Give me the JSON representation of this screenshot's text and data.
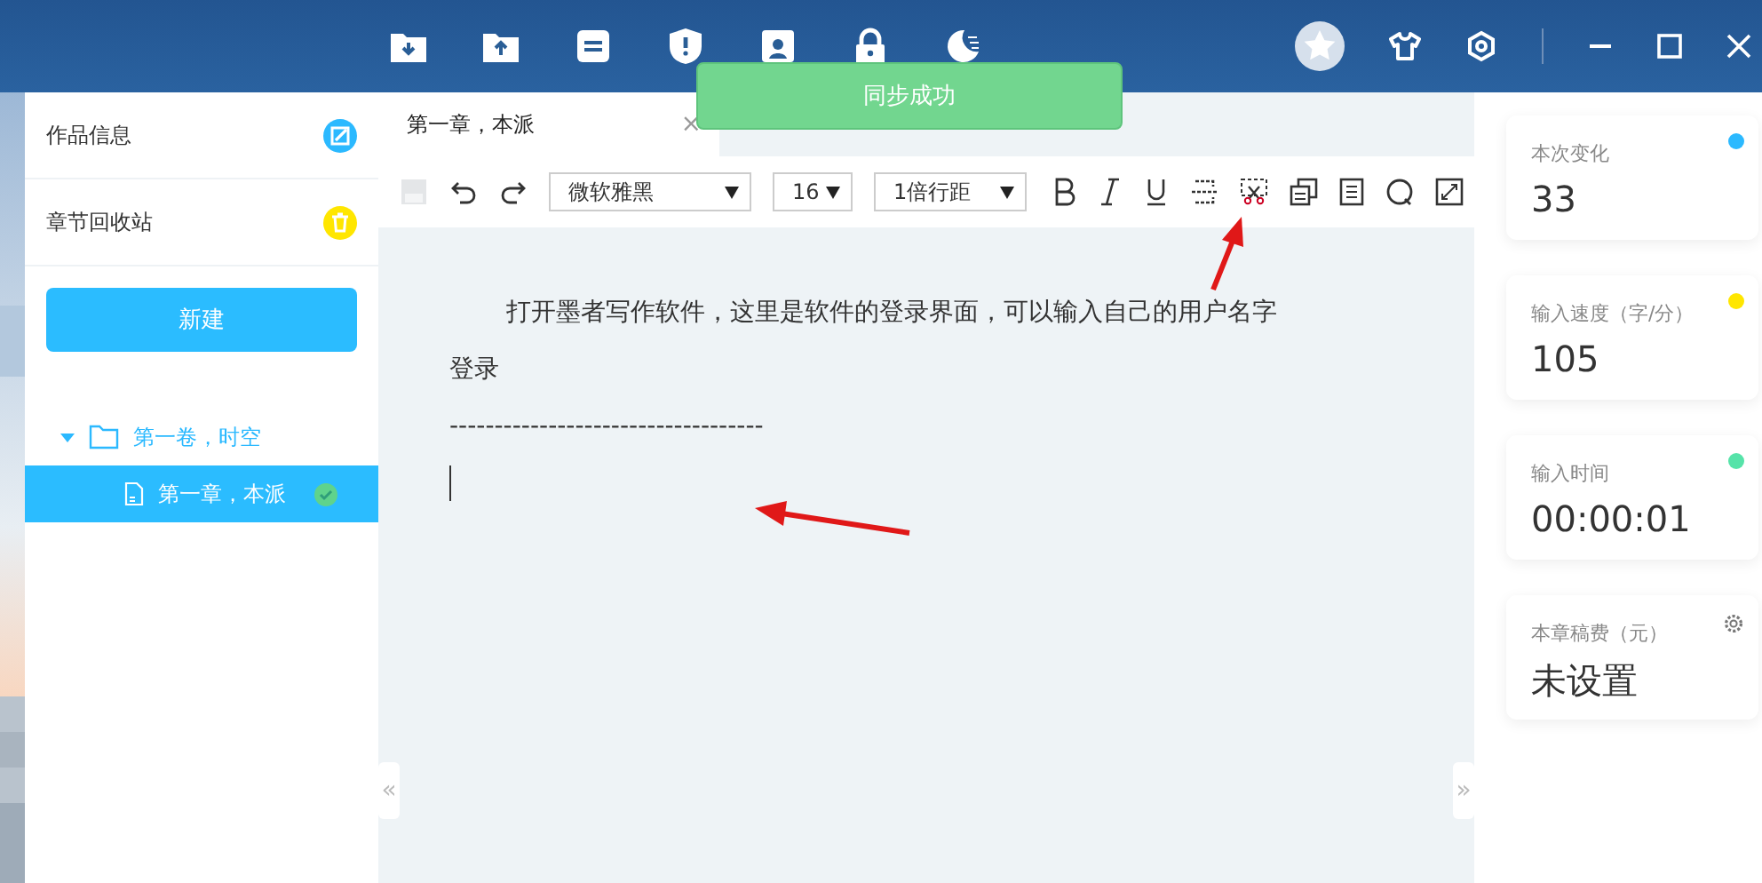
{
  "toast": {
    "text": "同步成功"
  },
  "sidebar": {
    "items": [
      {
        "label": "作品信息",
        "kind": "edit"
      },
      {
        "label": "章节回收站",
        "kind": "trash"
      }
    ],
    "new_button": "新建",
    "tree": [
      {
        "label": "第一卷，时空",
        "expanded": true,
        "selected": false,
        "children": [
          {
            "label": "第一章，本派",
            "selected": true,
            "saved": true
          }
        ]
      }
    ]
  },
  "tab": {
    "label": "第一章，本派",
    "close": "×"
  },
  "toolbar": {
    "font": "微软雅黑",
    "size": "16",
    "spacing": "1倍行距"
  },
  "editor": {
    "lines": [
      "打开墨者写作软件，这里是软件的登录界面，可以输入自己的用户名字",
      "登录",
      "-----------------------------------"
    ]
  },
  "stats": [
    {
      "label": "本次变化",
      "value": "33",
      "color": "#2bb9ff",
      "kind": "dot"
    },
    {
      "label": "输入速度（字/分）",
      "value": "105",
      "color": "#ffe600",
      "kind": "dot"
    },
    {
      "label": "输入时间",
      "value": "00:00:01",
      "color": "#56e3a9",
      "kind": "dot"
    },
    {
      "label": "本章稿费（元）",
      "value": "未设置",
      "kind": "settings"
    }
  ],
  "collapse_left": "«",
  "collapse_right": "»"
}
